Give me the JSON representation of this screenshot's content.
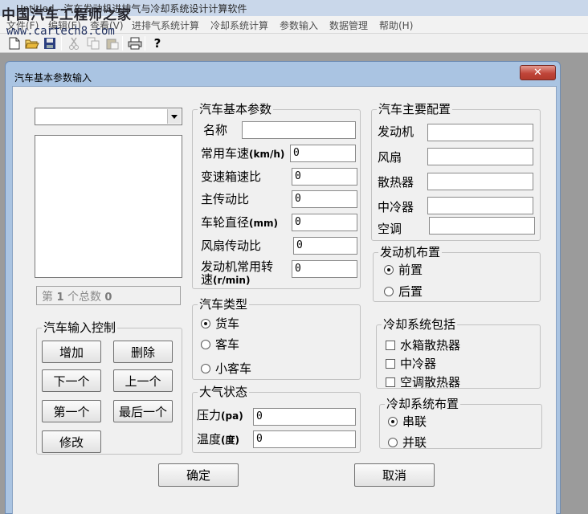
{
  "app": {
    "title": "Untitled - 汽车发动机进排气与冷却系统设计计算软件",
    "watermark_line1": "中国汽车工程师之家",
    "watermark_line2": "www.cartech8.com"
  },
  "menu": [
    "文件(F)",
    "编辑(E)",
    "查看(V)",
    "进排气系统计算",
    "冷却系统计算",
    "参数输入",
    "数据管理",
    "帮助(H)"
  ],
  "toolbar": {
    "icons": [
      "new-icon",
      "open-icon",
      "save-icon",
      "cut-icon",
      "copy-icon",
      "paste-icon",
      "print-icon",
      "help-icon"
    ],
    "help_glyph": "?"
  },
  "dialog": {
    "title": "汽车基本参数输入",
    "close_glyph": "✕",
    "record_nav": {
      "prefix": "第",
      "current": "1",
      "middle": "个总数",
      "total": "0"
    },
    "basic_params": {
      "title": "汽车基本参数",
      "name_label": "名称",
      "name_value": "",
      "speed_label": "常用车速",
      "speed_unit": "(km/h)",
      "speed_value": "0",
      "gearbox_label": "变速箱速比",
      "gearbox_value": "0",
      "final_drive_label": "主传动比",
      "final_drive_value": "0",
      "wheel_label": "车轮直径",
      "wheel_unit": "(mm)",
      "wheel_value": "0",
      "fan_ratio_label": "风扇传动比",
      "fan_ratio_value": "0",
      "engine_speed_label_1": "发动机常用转",
      "engine_speed_label_2": "速",
      "engine_speed_unit": "(r/min)",
      "engine_speed_value": "0"
    },
    "main_config": {
      "title": "汽车主要配置",
      "engine_label": "发动机",
      "fan_label": "风扇",
      "radiator_label": "散热器",
      "intercooler_label": "中冷器",
      "ac_label": "空调",
      "engine_value": "",
      "fan_value": "",
      "radiator_value": "",
      "intercooler_value": "",
      "ac_value": ""
    },
    "engine_layout": {
      "title": "发动机布置",
      "options": [
        "前置",
        "后置"
      ],
      "selected": "前置"
    },
    "vehicle_type": {
      "title": "汽车类型",
      "options": [
        "货车",
        "客车",
        "小客车"
      ],
      "selected": "货车"
    },
    "atmosphere": {
      "title": "大气状态",
      "pressure_label": "压力",
      "pressure_unit": "(pa)",
      "pressure_value": "0",
      "temp_label": "温度",
      "temp_unit": "(度)",
      "temp_value": "0"
    },
    "cooling_includes": {
      "title": "冷却系统包括",
      "options": [
        "水箱散热器",
        "中冷器",
        "空调散热器"
      ]
    },
    "cooling_layout": {
      "title": "冷却系统布置",
      "options": [
        "串联",
        "并联"
      ],
      "selected": "串联"
    },
    "input_control": {
      "title": "汽车输入控制",
      "add": "增加",
      "delete": "删除",
      "next": "下一个",
      "prev": "上一个",
      "first": "第一个",
      "last": "最后一个",
      "modify": "修改"
    },
    "ok": "确定",
    "cancel": "取消"
  }
}
